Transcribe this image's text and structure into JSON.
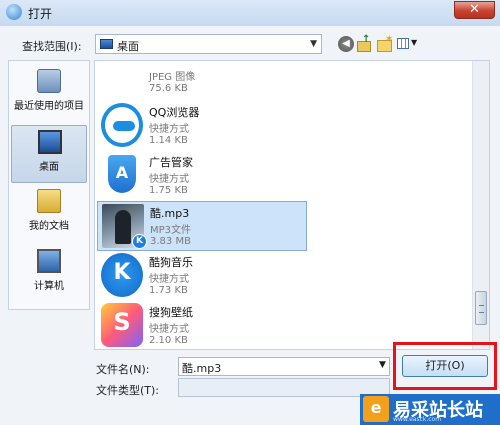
{
  "window": {
    "title": "打开",
    "close_glyph": "✕"
  },
  "look_in": {
    "label": "查找范围(I):",
    "value": "桌面"
  },
  "places": [
    {
      "label": "最近使用的项目",
      "icon": "recent-icon",
      "selected": false
    },
    {
      "label": "桌面",
      "icon": "desktop-icon",
      "selected": true
    },
    {
      "label": "我的文档",
      "icon": "documents-icon",
      "selected": false
    },
    {
      "label": "计算机",
      "icon": "computer-icon",
      "selected": false
    }
  ],
  "files": [
    {
      "name": "",
      "type": "JPEG 图像",
      "size": "75.6 KB",
      "icon": "jpeg-thumbnail-icon"
    },
    {
      "name": "QQ浏览器",
      "type": "快捷方式",
      "size": "1.14 KB",
      "icon": "qq-browser-icon"
    },
    {
      "name": "广告管家",
      "type": "快捷方式",
      "size": "1.75 KB",
      "icon": "ad-manager-icon"
    },
    {
      "name": "酷.mp3",
      "type": "MP3文件",
      "size": "3.83 MB",
      "icon": "kugou-mp3-thumbnail-icon",
      "selected": true
    },
    {
      "name": "酷狗音乐",
      "type": "快捷方式",
      "size": "1.73 KB",
      "icon": "kugou-music-icon"
    },
    {
      "name": "搜狗壁纸",
      "type": "快捷方式",
      "size": "2.10 KB",
      "icon": "sogou-wallpaper-icon"
    }
  ],
  "icons": {
    "qq_glyph": "",
    "ad_glyph": "A",
    "kugou_glyph": "K",
    "kugou_badge": "K",
    "sogou_glyph": "S"
  },
  "file_name": {
    "label": "文件名(N):",
    "value": "酷.mp3"
  },
  "file_type": {
    "label": "文件类型(T):",
    "value": ""
  },
  "buttons": {
    "open": "打开(O)"
  },
  "watermark": {
    "logo_glyph": "e",
    "text": "易采站长站",
    "sub": "www.easck.com"
  },
  "colors": {
    "selection": "#cde3fa",
    "highlight_box": "#e5141b",
    "watermark_bg": "#1f6ec9"
  }
}
